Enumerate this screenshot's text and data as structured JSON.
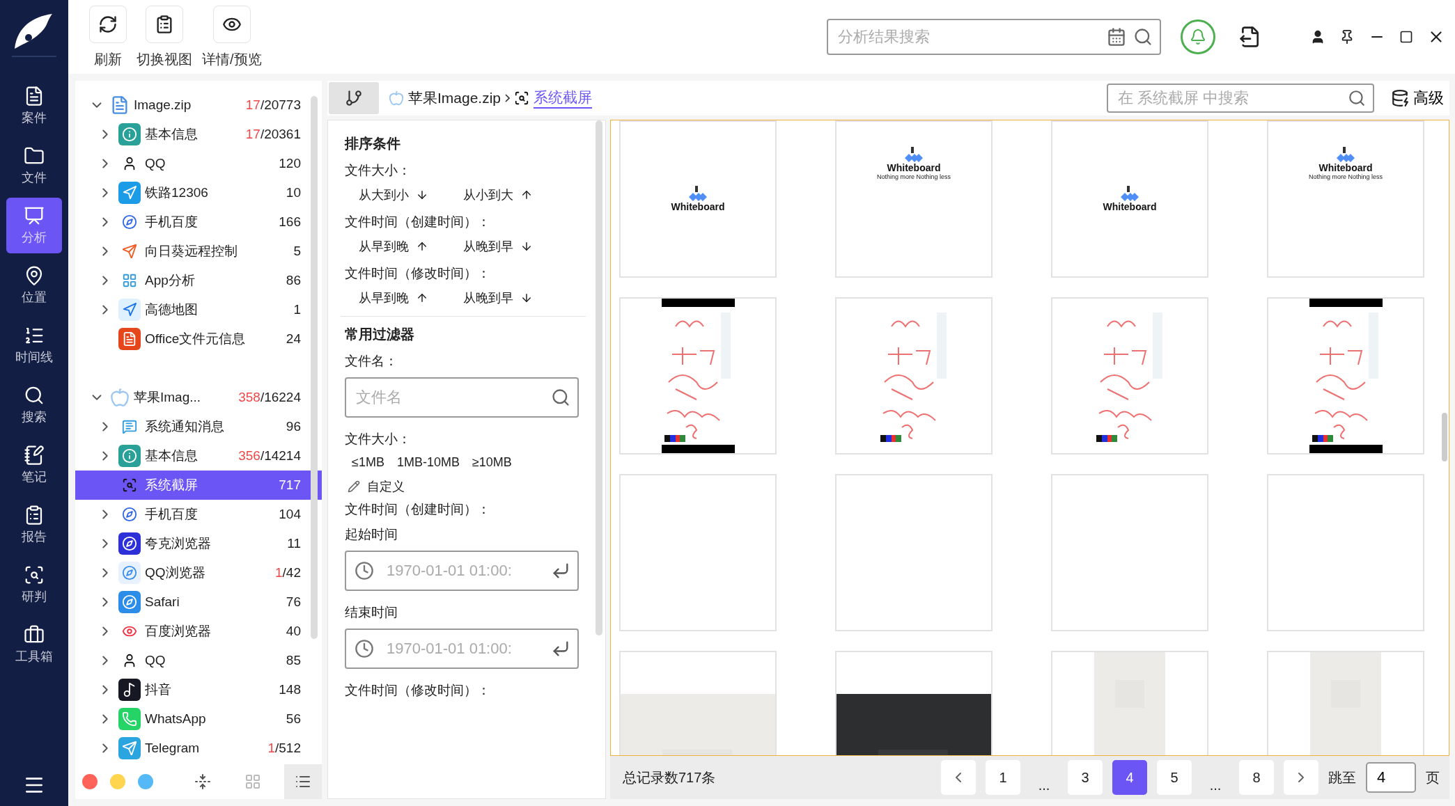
{
  "nav": {
    "items": [
      {
        "label": "案件",
        "selected": false
      },
      {
        "label": "文件",
        "selected": false
      },
      {
        "label": "分析",
        "selected": true
      },
      {
        "label": "位置",
        "selected": false
      },
      {
        "label": "时间线",
        "selected": false
      },
      {
        "label": "搜索",
        "selected": false
      },
      {
        "label": "笔记",
        "selected": false
      },
      {
        "label": "报告",
        "selected": false
      },
      {
        "label": "研判",
        "selected": false
      },
      {
        "label": "工具箱",
        "selected": false
      }
    ]
  },
  "toolbar": {
    "buttons": [
      {
        "label": "刷新"
      },
      {
        "label": "切换视图"
      },
      {
        "label": "详情/预览"
      }
    ],
    "search": {
      "placeholder": "分析结果搜索"
    }
  },
  "tree": {
    "groups": [
      {
        "label": "Image.zip",
        "hit": "17",
        "total": "/20773",
        "expanded": true,
        "children": [
          {
            "label": "基本信息",
            "hit": "17",
            "total": "/20361",
            "expandable": true,
            "selected": false
          },
          {
            "label": "QQ",
            "total": "120",
            "expandable": true,
            "selected": false
          },
          {
            "label": "铁路12306",
            "total": "10",
            "expandable": true,
            "selected": false
          },
          {
            "label": "手机百度",
            "total": "166",
            "expandable": true,
            "selected": false
          },
          {
            "label": "向日葵远程控制",
            "total": "5",
            "expandable": true,
            "selected": false
          },
          {
            "label": "App分析",
            "total": "86",
            "expandable": true,
            "selected": false
          },
          {
            "label": "高德地图",
            "total": "1",
            "expandable": true,
            "selected": false
          },
          {
            "label": "Office文件元信息",
            "total": "24",
            "expandable": false,
            "selected": false
          }
        ]
      },
      {
        "label": "苹果Imag...",
        "hit": "358",
        "total": "/16224",
        "expanded": true,
        "children": [
          {
            "label": "系统通知消息",
            "total": "96",
            "expandable": true,
            "selected": false
          },
          {
            "label": "基本信息",
            "hit": "356",
            "total": "/14214",
            "expandable": true,
            "selected": false
          },
          {
            "label": "系统截屏",
            "total": "717",
            "expandable": false,
            "selected": true
          },
          {
            "label": "手机百度",
            "total": "104",
            "expandable": true,
            "selected": false
          },
          {
            "label": "夸克浏览器",
            "total": "11",
            "expandable": true,
            "selected": false
          },
          {
            "label": "QQ浏览器",
            "hit": "1",
            "total": "/42",
            "expandable": true,
            "selected": false
          },
          {
            "label": "Safari",
            "total": "76",
            "expandable": true,
            "selected": false
          },
          {
            "label": "百度浏览器",
            "total": "40",
            "expandable": true,
            "selected": false
          },
          {
            "label": "QQ",
            "total": "85",
            "expandable": true,
            "selected": false
          },
          {
            "label": "抖音",
            "total": "148",
            "expandable": true,
            "selected": false
          },
          {
            "label": "WhatsApp",
            "total": "56",
            "expandable": true,
            "selected": false
          },
          {
            "label": "Telegram",
            "hit": "1",
            "total": "/512",
            "expandable": true,
            "selected": false
          }
        ]
      }
    ],
    "tags": [
      {
        "color": "#ff6259"
      },
      {
        "color": "#ffd54f"
      },
      {
        "color": "#55b9f7"
      }
    ]
  },
  "breadcrumb": {
    "items": [
      {
        "label": "苹果Image.zip",
        "selected": false
      },
      {
        "label": "系统截屏",
        "selected": true
      }
    ],
    "search": {
      "placeholder": "在 系统截屏 中搜索"
    },
    "advanced": "高级"
  },
  "sort": {
    "title": "排序条件",
    "groups": [
      {
        "label": "文件大小：",
        "options": [
          {
            "label": "从大到小",
            "kind": "down"
          },
          {
            "label": "从小到大",
            "kind": "up"
          }
        ]
      },
      {
        "label": "文件时间（创建时间）：",
        "options": [
          {
            "label": "从早到晚",
            "kind": "up"
          },
          {
            "label": "从晚到早",
            "kind": "down"
          }
        ]
      },
      {
        "label": "文件时间（修改时间）：",
        "options": [
          {
            "label": "从早到晚",
            "kind": "up"
          },
          {
            "label": "从晚到早",
            "kind": "down"
          }
        ]
      }
    ]
  },
  "filters": {
    "title": "常用过滤器",
    "name_label": "文件名：",
    "name_placeholder": "文件名",
    "size_label": "文件大小：",
    "sizes": [
      "≤1MB",
      "1MB-10MB",
      "≥10MB"
    ],
    "custom": "自定义",
    "created_label": "文件时间（创建时间）：",
    "start_label": "起始时间",
    "start_placeholder": "1970-01-01 01:00:",
    "end_label": "结束时间",
    "end_placeholder": "1970-01-01 01:00:",
    "modified_label": "文件时间（修改时间）："
  },
  "grid": {
    "items": [
      {
        "kind": "splash",
        "title": "Whiteboard"
      },
      {
        "kind": "splash_tagline",
        "title": "Whiteboard",
        "tagline": "Nothing more Nothing less"
      },
      {
        "kind": "splash",
        "title": "Whiteboard"
      },
      {
        "kind": "splash_tagline",
        "title": "Whiteboard",
        "tagline": "Nothing more Nothing less"
      },
      {
        "kind": "handwriting_bars"
      },
      {
        "kind": "handwriting"
      },
      {
        "kind": "handwriting"
      },
      {
        "kind": "handwriting_bars"
      },
      {
        "kind": "blank"
      },
      {
        "kind": "blank"
      },
      {
        "kind": "blank"
      },
      {
        "kind": "blank"
      },
      {
        "kind": "light_bottom"
      },
      {
        "kind": "dark_bottom"
      },
      {
        "kind": "light_stripe"
      },
      {
        "kind": "light_stripe"
      }
    ]
  },
  "pager": {
    "total": "总记录数717条",
    "pages": [
      {
        "label": "1",
        "kind": "page",
        "selected": false
      },
      {
        "label": "...",
        "kind": "gap"
      },
      {
        "label": "3",
        "kind": "page",
        "selected": false
      },
      {
        "label": "4",
        "kind": "page",
        "selected": true
      },
      {
        "label": "5",
        "kind": "page",
        "selected": false
      },
      {
        "label": "...",
        "kind": "gap"
      },
      {
        "label": "8",
        "kind": "page",
        "selected": false
      }
    ],
    "jump_label": "跳至",
    "jump_value": "4",
    "page_unit": "页"
  }
}
